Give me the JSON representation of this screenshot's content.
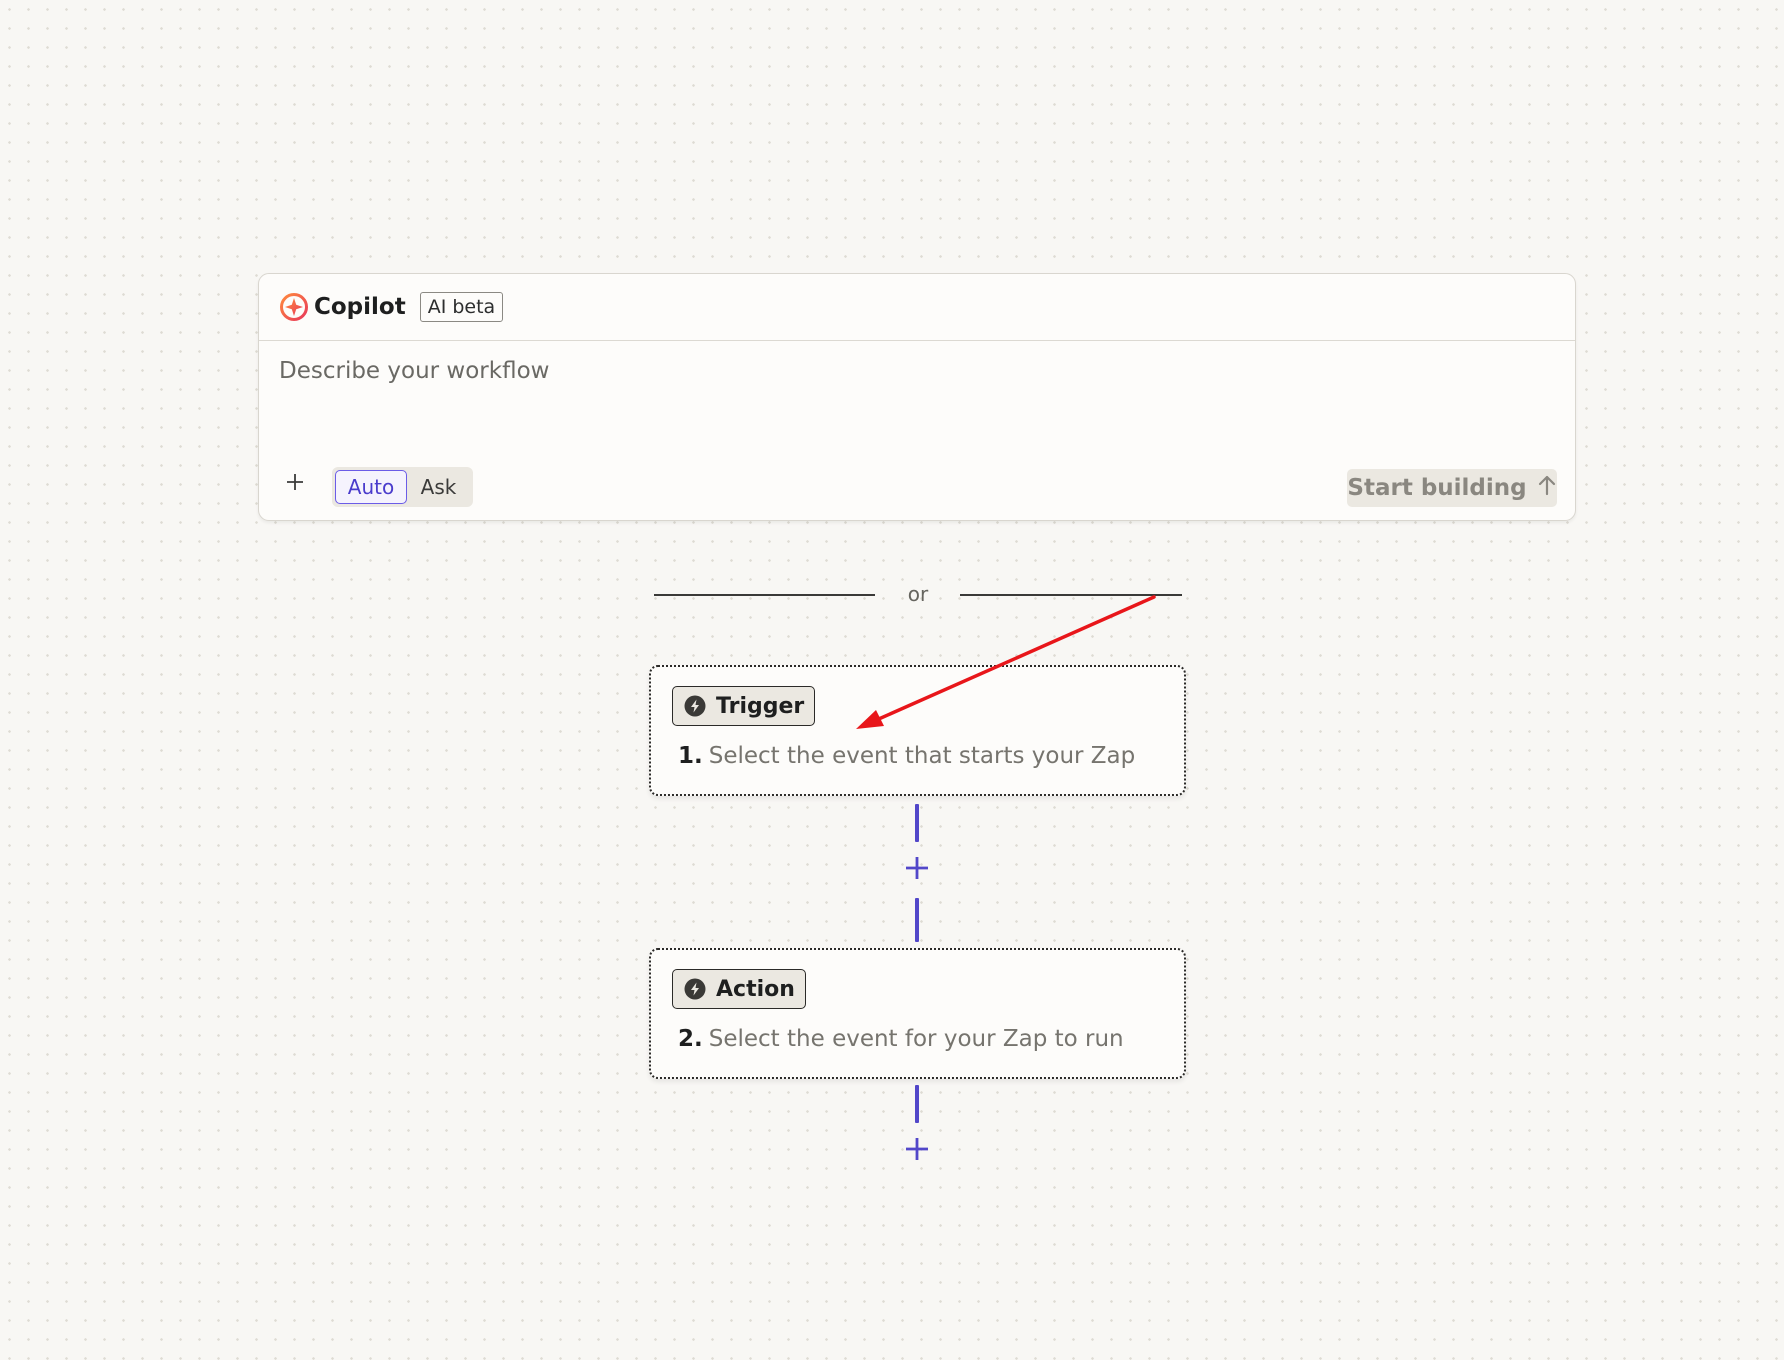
{
  "copilot": {
    "title": "Copilot",
    "badge": "AI beta",
    "input_placeholder": "Describe your workflow",
    "input_value": "",
    "modes": {
      "auto": "Auto",
      "ask": "Ask",
      "selected": "Auto"
    },
    "start_button": "Start building",
    "icons": {
      "logo": "copilot-logo-icon",
      "attach": "plus-icon",
      "start": "arrow-up-icon"
    }
  },
  "divider": {
    "text": "or"
  },
  "steps": [
    {
      "type": "Trigger",
      "number": "1.",
      "description": "Select the event that starts your Zap",
      "icon": "bolt-icon"
    },
    {
      "type": "Action",
      "number": "2.",
      "description": "Select the event for your Zap to run",
      "icon": "bolt-icon"
    }
  ],
  "colors": {
    "accent": "#5247c9",
    "annotation_arrow": "#e8161a",
    "brand_orange": "#ff5a2b",
    "canvas_bg": "#f8f7f4"
  }
}
